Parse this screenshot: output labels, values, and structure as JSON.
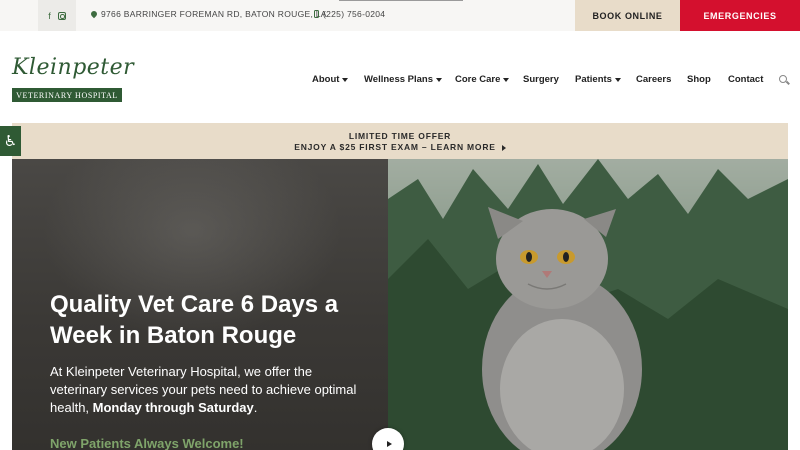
{
  "topbar": {
    "social": [
      "facebook-icon",
      "instagram-icon"
    ],
    "address": "9766 BARRINGER FOREMAN RD, BATON ROUGE, LA",
    "phone": "(225) 756-0204",
    "book_label": "BOOK ONLINE",
    "emergency_label": "EMERGENCIES"
  },
  "logo": {
    "script": "Kleinpeter",
    "band": "VETERINARY HOSPITAL"
  },
  "nav": {
    "items": [
      {
        "label": "About",
        "dropdown": true
      },
      {
        "label": "Wellness Plans",
        "dropdown": true
      },
      {
        "label": "Core Care",
        "dropdown": true
      },
      {
        "label": "Surgery",
        "dropdown": false
      },
      {
        "label": "Patients",
        "dropdown": true
      },
      {
        "label": "Careers",
        "dropdown": false
      },
      {
        "label": "Shop",
        "dropdown": false
      },
      {
        "label": "Contact",
        "dropdown": false
      }
    ],
    "search_icon": "search-icon"
  },
  "accessibility": {
    "icon": "wheelchair-icon",
    "glyph": "♿"
  },
  "promo": {
    "line1": "LIMITED TIME OFFER",
    "line2": "ENJOY A $25 FIRST EXAM – LEARN MORE"
  },
  "hero": {
    "title": "Quality Vet Care 6 Days a Week in Baton Rouge",
    "text_before": "At Kleinpeter Veterinary Hospital, we offer the veterinary services your pets need to achieve optimal health, ",
    "text_bold": "Monday through Saturday",
    "text_after": ".",
    "new_patients": "New Patients Always Welcome!"
  },
  "colors": {
    "brand_green": "#2f5a34",
    "beige": "#e8dcc9",
    "emergency_red": "#d4102e",
    "accent_green": "#7fa46a"
  }
}
